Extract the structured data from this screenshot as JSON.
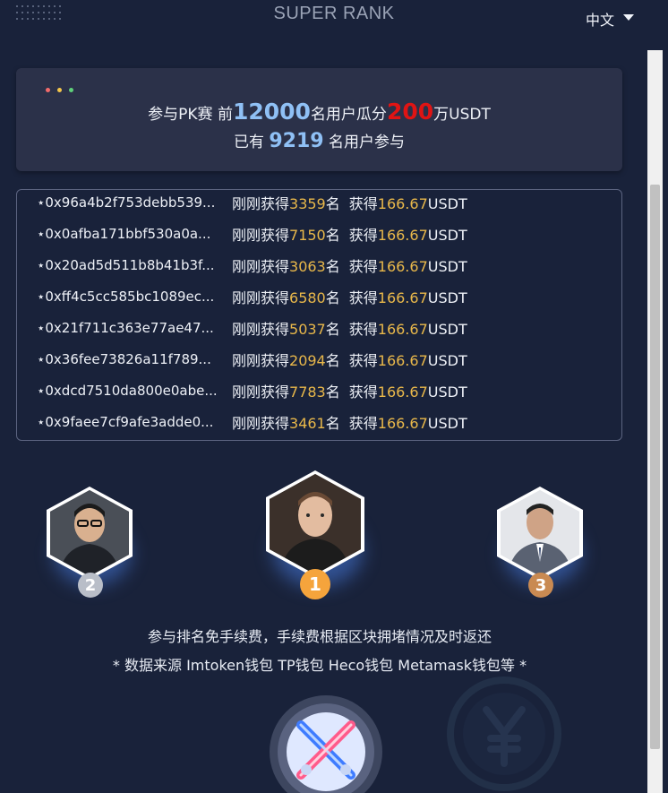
{
  "header": {
    "brand": "SUPER RANK",
    "language": "中文"
  },
  "banner": {
    "prefix": "参与PK赛 前",
    "top_users": "12000",
    "mid": "名用户瓜分",
    "prize": "200",
    "suffix": "万USDT",
    "joined_prefix": "已有 ",
    "joined_count": "9219",
    "joined_suffix": " 名用户参与",
    "dot_colors": [
      "#f26b6b",
      "#f4c64b",
      "#5fd07a"
    ]
  },
  "feed": {
    "rows": [
      {
        "address": "⋆0x96a4b2f753debb539...",
        "label": "刚刚获得",
        "rank": "3359",
        "rank_unit": "名",
        "get_label": "获得",
        "amount": "166.67",
        "currency": "USDT"
      },
      {
        "address": "⋆0x0afba171bbf530a0a...",
        "label": "刚刚获得",
        "rank": "7150",
        "rank_unit": "名",
        "get_label": "获得",
        "amount": "166.67",
        "currency": "USDT"
      },
      {
        "address": "⋆0x20ad5d511b8b41b3f...",
        "label": "刚刚获得",
        "rank": "3063",
        "rank_unit": "名",
        "get_label": "获得",
        "amount": "166.67",
        "currency": "USDT"
      },
      {
        "address": "⋆0xff4c5cc585bc1089ec...",
        "label": "刚刚获得",
        "rank": "6580",
        "rank_unit": "名",
        "get_label": "获得",
        "amount": "166.67",
        "currency": "USDT"
      },
      {
        "address": "⋆0x21f711c363e77ae47...",
        "label": "刚刚获得",
        "rank": "5037",
        "rank_unit": "名",
        "get_label": "获得",
        "amount": "166.67",
        "currency": "USDT"
      },
      {
        "address": "⋆0x36fee73826a11f789...",
        "label": "刚刚获得",
        "rank": "2094",
        "rank_unit": "名",
        "get_label": "获得",
        "amount": "166.67",
        "currency": "USDT"
      },
      {
        "address": "⋆0xdcd7510da800e0abe...",
        "label": "刚刚获得",
        "rank": "7783",
        "rank_unit": "名",
        "get_label": "获得",
        "amount": "166.67",
        "currency": "USDT"
      },
      {
        "address": "⋆0x9faee7cf9afe3adde0...",
        "label": "刚刚获得",
        "rank": "3461",
        "rank_unit": "名",
        "get_label": "获得",
        "amount": "166.67",
        "currency": "USDT"
      }
    ]
  },
  "podium": {
    "first": {
      "rank": "1",
      "badge_color": "#f5a43c"
    },
    "second": {
      "rank": "2",
      "badge_color": "#b9bec8"
    },
    "third": {
      "rank": "3",
      "badge_color": "#c98a52"
    }
  },
  "notes": {
    "line1": "参与排名免手续费，手续费根据区块拥堵情况及时返还",
    "line2": "* 数据来源 Imtoken钱包 TP钱包 Heco钱包 Metamask钱包等 *"
  },
  "icons": {
    "menu": "grid-dots-icon",
    "language_toggle": "caret-down-icon",
    "background": "yen-coin-icon",
    "pk": "crossed-lightsabers-icon"
  }
}
